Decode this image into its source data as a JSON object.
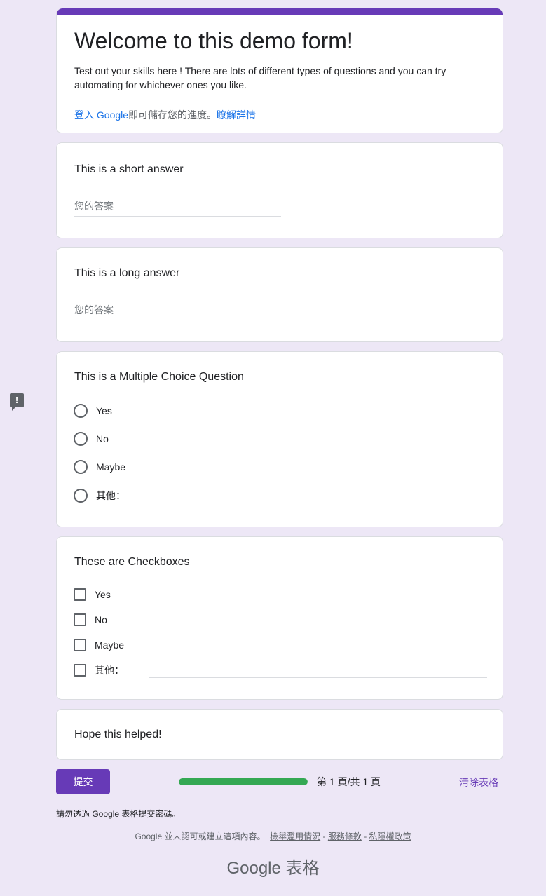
{
  "form": {
    "title": "Welcome to this demo form!",
    "description": "Test out your skills here ! There are lots of different types of questions and you can try automating for whichever ones you like.",
    "signin_link": "登入 Google",
    "signin_text": "即可儲存您的進度。",
    "learn_more": "瞭解詳情",
    "accent_color": "#673ab7"
  },
  "questions": {
    "short": {
      "title": "This is a short answer",
      "placeholder": "您的答案"
    },
    "long": {
      "title": "This is a long answer",
      "placeholder": "您的答案"
    },
    "mc": {
      "title": "This is a Multiple Choice Question",
      "options": [
        "Yes",
        "No",
        "Maybe",
        "其他："
      ]
    },
    "cb": {
      "title": "These are Checkboxes",
      "options": [
        "Yes",
        "No",
        "Maybe",
        "其他："
      ]
    },
    "final": {
      "text": "Hope this helped!"
    }
  },
  "footer": {
    "submit": "提交",
    "progress_fraction": 1.0,
    "page_count": "第 1 頁/共 1 頁",
    "clear": "清除表格",
    "password_warning": "請勿透過 Google 表格提交密碼。",
    "disclaimer": "Google 並未認可或建立這項內容。",
    "report": "檢舉濫用情況",
    "terms": "服務條款",
    "privacy": "私隱權政策",
    "brand": "Google 表格",
    "separator": "-"
  },
  "icons": {
    "report": "report-feedback-icon"
  }
}
